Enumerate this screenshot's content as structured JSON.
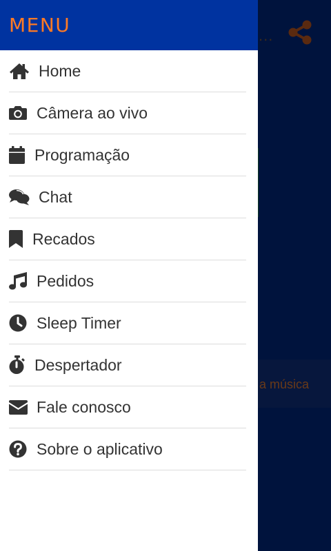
{
  "drawer": {
    "title": "MENU",
    "items": [
      {
        "label": "Home",
        "icon": "home-icon"
      },
      {
        "label": "Câmera ao vivo",
        "icon": "camera-icon"
      },
      {
        "label": "Programação",
        "icon": "calendar-icon"
      },
      {
        "label": "Chat",
        "icon": "chat-icon"
      },
      {
        "label": "Recados",
        "icon": "bookmark-icon"
      },
      {
        "label": "Pedidos",
        "icon": "music-icon"
      },
      {
        "label": "Sleep Timer",
        "icon": "clock-icon"
      },
      {
        "label": "Despertador",
        "icon": "stopwatch-icon"
      },
      {
        "label": "Fale conosco",
        "icon": "envelope-icon"
      },
      {
        "label": "Sobre o aplicativo",
        "icon": "question-circle-icon"
      }
    ]
  },
  "background": {
    "ellipsis": "...",
    "partial_text": "a música",
    "share_icon": "share-icon"
  },
  "colors": {
    "header_bg": "#0033a0",
    "title": "#ff7a24",
    "text": "#333333",
    "overlay_bg": "#00133d"
  }
}
